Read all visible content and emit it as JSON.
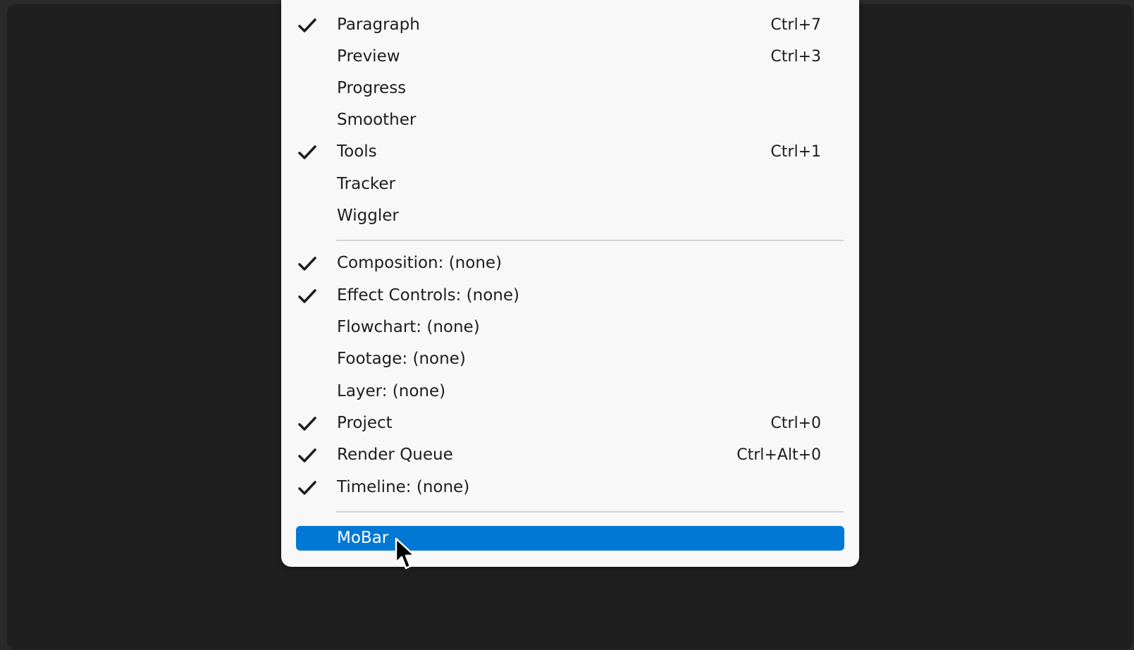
{
  "menu": {
    "group1": [
      {
        "label": "Paragraph",
        "shortcut": "Ctrl+7",
        "checked": true
      },
      {
        "label": "Preview",
        "shortcut": "Ctrl+3",
        "checked": false
      },
      {
        "label": "Progress",
        "shortcut": "",
        "checked": false
      },
      {
        "label": "Smoother",
        "shortcut": "",
        "checked": false
      },
      {
        "label": "Tools",
        "shortcut": "Ctrl+1",
        "checked": true
      },
      {
        "label": "Tracker",
        "shortcut": "",
        "checked": false
      },
      {
        "label": "Wiggler",
        "shortcut": "",
        "checked": false
      }
    ],
    "group2": [
      {
        "label": "Composition: (none)",
        "shortcut": "",
        "checked": true
      },
      {
        "label": "Effect Controls: (none)",
        "shortcut": "",
        "checked": true
      },
      {
        "label": "Flowchart: (none)",
        "shortcut": "",
        "checked": false
      },
      {
        "label": "Footage: (none)",
        "shortcut": "",
        "checked": false
      },
      {
        "label": "Layer: (none)",
        "shortcut": "",
        "checked": false
      },
      {
        "label": "Project",
        "shortcut": "Ctrl+0",
        "checked": true
      },
      {
        "label": "Render Queue",
        "shortcut": "Ctrl+Alt+0",
        "checked": true
      },
      {
        "label": "Timeline: (none)",
        "shortcut": "",
        "checked": true
      }
    ],
    "group3": [
      {
        "label": "MoBar",
        "shortcut": "",
        "checked": false,
        "highlighted": true
      }
    ]
  },
  "icons": {
    "check": "checkmark-icon",
    "cursor": "mouse-pointer-icon"
  },
  "colors": {
    "highlight": "#0078d4",
    "menu_bg": "#f8f8f8",
    "backdrop": "#1f1f1f"
  }
}
